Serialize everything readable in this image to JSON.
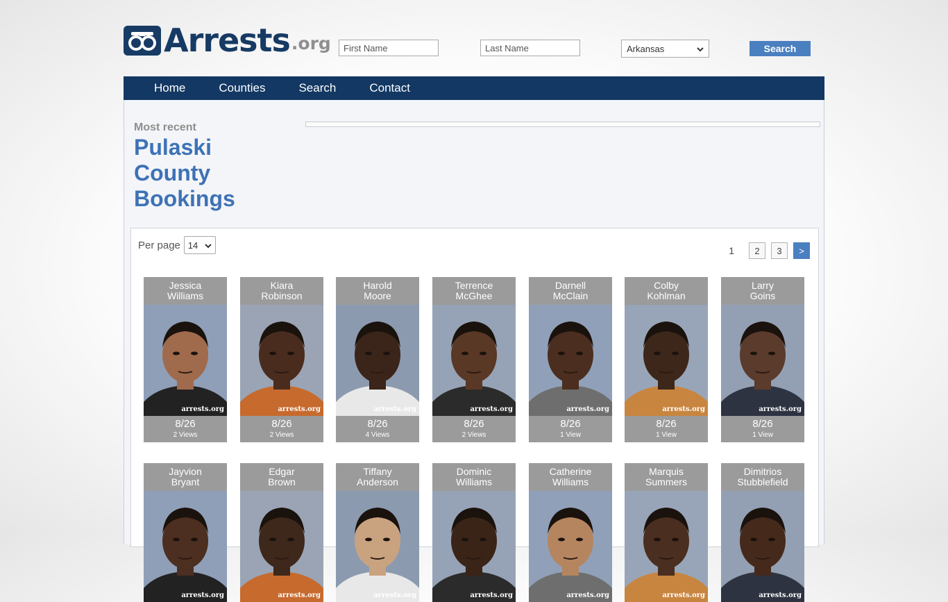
{
  "brand": {
    "name": "Arrests",
    "tld": ".org"
  },
  "header": {
    "first_name_placeholder": "First Name",
    "last_name_placeholder": "Last Name",
    "state_selected": "Arkansas",
    "search_label": "Search"
  },
  "nav": [
    "Home",
    "Counties",
    "Search",
    "Contact"
  ],
  "page": {
    "kicker": "Most recent",
    "title": "Pulaski County Bookings"
  },
  "listing": {
    "per_page_label": "Per page",
    "per_page_value": "14",
    "current_page": "1",
    "pages": [
      "2",
      "3"
    ],
    "next_label": ">"
  },
  "watermark": "arrests.org",
  "bookings": [
    {
      "first": "Jessica",
      "last": "Williams",
      "date": "8/26",
      "views": "2 Views"
    },
    {
      "first": "Kiara",
      "last": "Robinson",
      "date": "8/26",
      "views": "2 Views"
    },
    {
      "first": "Harold",
      "last": "Moore",
      "date": "8/26",
      "views": "4 Views"
    },
    {
      "first": "Terrence",
      "last": "McGhee",
      "date": "8/26",
      "views": "2 Views"
    },
    {
      "first": "Darnell",
      "last": "McClain",
      "date": "8/26",
      "views": "1 View"
    },
    {
      "first": "Colby",
      "last": "Kohlman",
      "date": "8/26",
      "views": "1 View"
    },
    {
      "first": "Larry",
      "last": "Goins",
      "date": "8/26",
      "views": "1 View"
    },
    {
      "first": "Jayvion",
      "last": "Bryant",
      "date": "",
      "views": ""
    },
    {
      "first": "Edgar",
      "last": "Brown",
      "date": "",
      "views": ""
    },
    {
      "first": "Tiffany",
      "last": "Anderson",
      "date": "",
      "views": ""
    },
    {
      "first": "Dominic",
      "last": "Williams",
      "date": "",
      "views": ""
    },
    {
      "first": "Catherine",
      "last": "Williams",
      "date": "",
      "views": ""
    },
    {
      "first": "Marquis",
      "last": "Summers",
      "date": "",
      "views": ""
    },
    {
      "first": "Dimitrios",
      "last": "Stubblefield",
      "date": "",
      "views": ""
    }
  ],
  "colors": {
    "navy": "#133863",
    "accent": "#4a7fc0",
    "title": "#3e72b6",
    "card": "#9b9b9b"
  }
}
